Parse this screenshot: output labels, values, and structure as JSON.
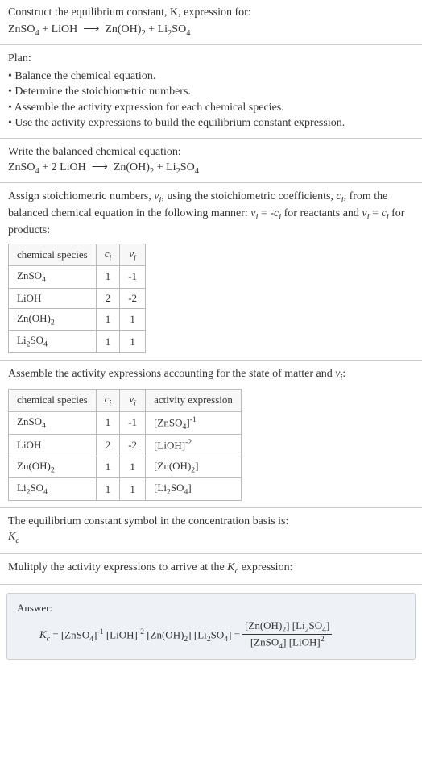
{
  "question": {
    "line1": "Construct the equilibrium constant, K, expression for:",
    "eq": "ZnSO₄ + LiOH ⟶ Zn(OH)₂ + Li₂SO₄"
  },
  "plan": {
    "title": "Plan:",
    "items": [
      "• Balance the chemical equation.",
      "• Determine the stoichiometric numbers.",
      "• Assemble the activity expression for each chemical species.",
      "• Use the activity expressions to build the equilibrium constant expression."
    ]
  },
  "balanced": {
    "title": "Write the balanced chemical equation:",
    "eq": "ZnSO₄ + 2 LiOH ⟶ Zn(OH)₂ + Li₂SO₄"
  },
  "stoich": {
    "text": "Assign stoichiometric numbers, νᵢ, using the stoichiometric coefficients, cᵢ, from the balanced chemical equation in the following manner: νᵢ = -cᵢ for reactants and νᵢ = cᵢ for products:",
    "headers": [
      "chemical species",
      "cᵢ",
      "νᵢ"
    ],
    "rows": [
      {
        "spec": "ZnSO₄",
        "c": "1",
        "v": "-1"
      },
      {
        "spec": "LiOH",
        "c": "2",
        "v": "-2"
      },
      {
        "spec": "Zn(OH)₂",
        "c": "1",
        "v": "1"
      },
      {
        "spec": "Li₂SO₄",
        "c": "1",
        "v": "1"
      }
    ]
  },
  "activity": {
    "text": "Assemble the activity expressions accounting for the state of matter and νᵢ:",
    "headers": [
      "chemical species",
      "cᵢ",
      "νᵢ",
      "activity expression"
    ],
    "rows": [
      {
        "spec": "ZnSO₄",
        "c": "1",
        "v": "-1",
        "act": "[ZnSO₄]⁻¹"
      },
      {
        "spec": "LiOH",
        "c": "2",
        "v": "-2",
        "act": "[LiOH]⁻²"
      },
      {
        "spec": "Zn(OH)₂",
        "c": "1",
        "v": "1",
        "act": "[Zn(OH)₂]"
      },
      {
        "spec": "Li₂SO₄",
        "c": "1",
        "v": "1",
        "act": "[Li₂SO₄]"
      }
    ]
  },
  "basis": {
    "line1": "The equilibrium constant symbol in the concentration basis is:",
    "symbol": "K_c"
  },
  "multiply": {
    "text": "Mulitply the activity expressions to arrive at the K_c expression:"
  },
  "answer": {
    "label": "Answer:",
    "lhs": "K_c = [ZnSO₄]⁻¹ [LiOH]⁻² [Zn(OH)₂] [Li₂SO₄] =",
    "num": "[Zn(OH)₂] [Li₂SO₄]",
    "den": "[ZnSO₄] [LiOH]²"
  }
}
